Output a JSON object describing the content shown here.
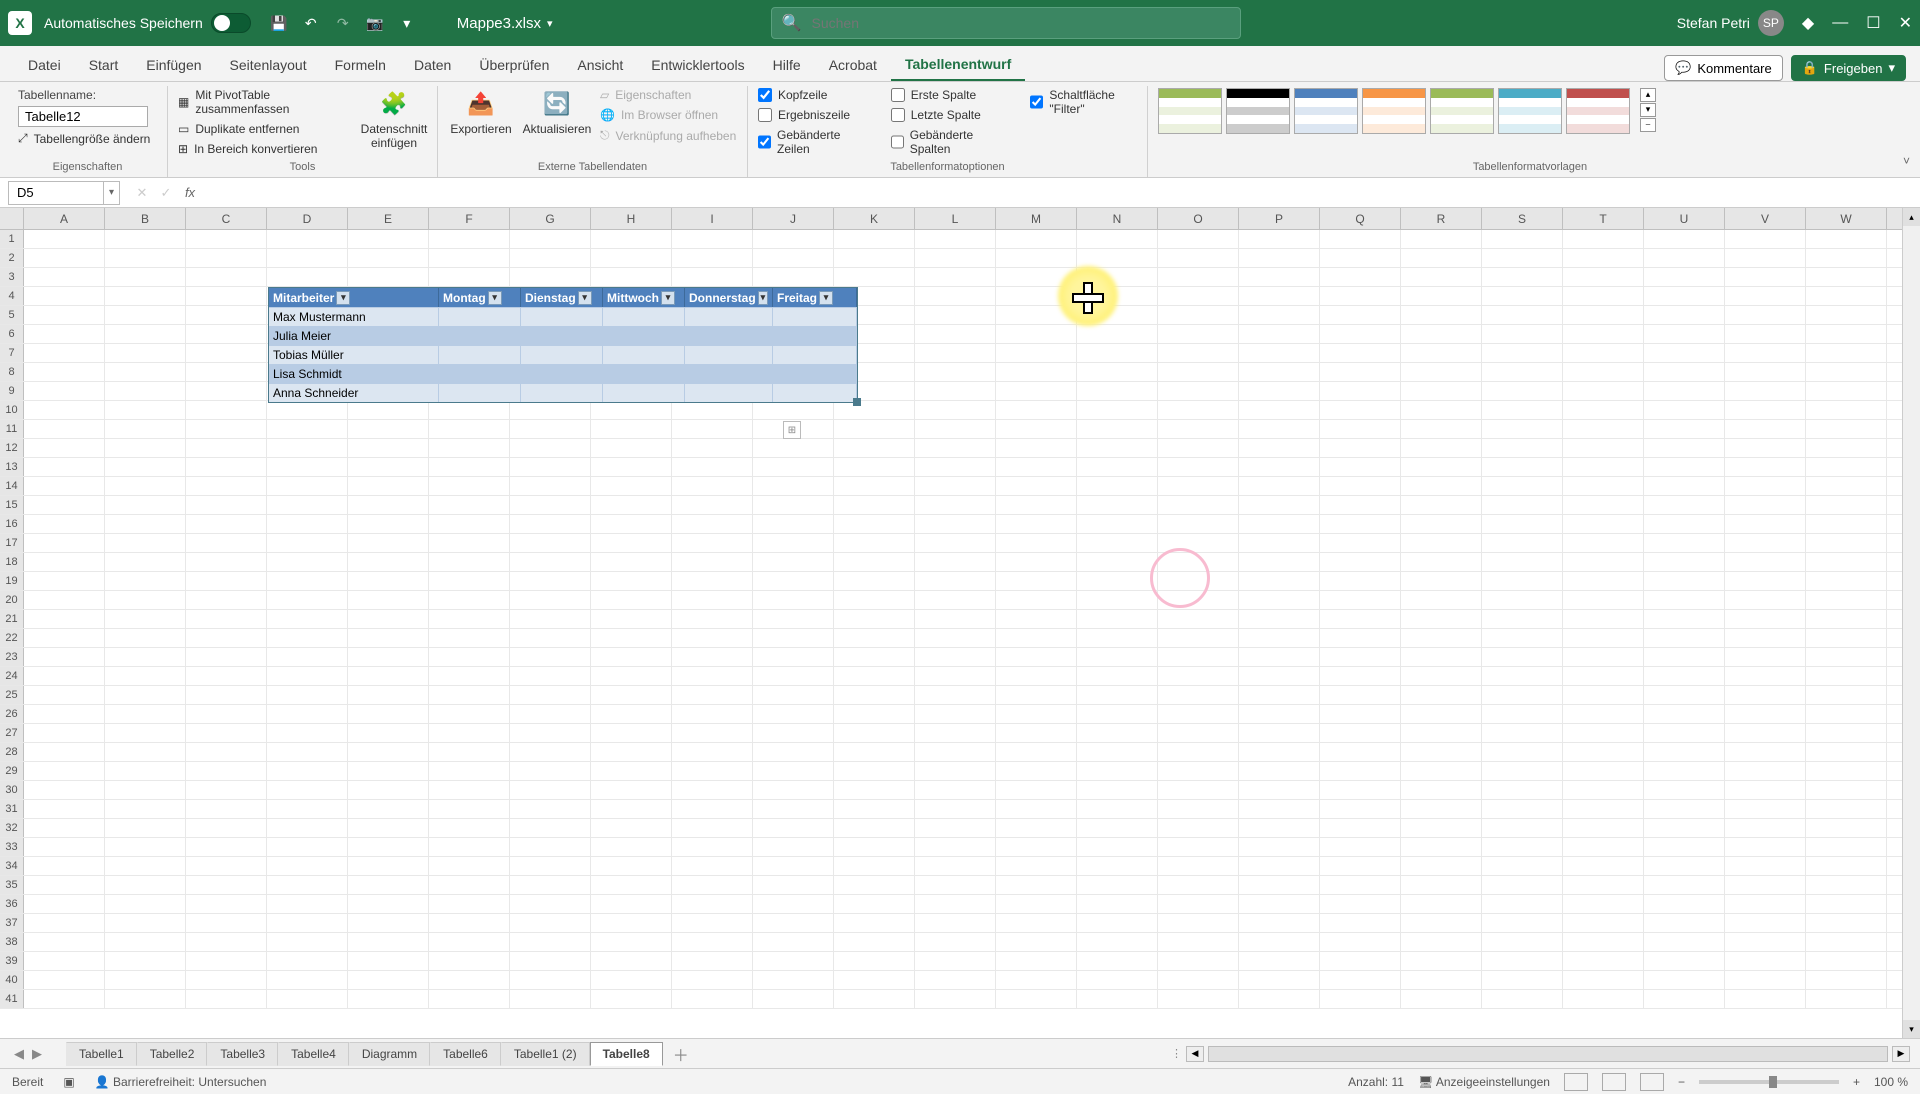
{
  "titlebar": {
    "autosave_label": "Automatisches Speichern",
    "filename": "Mappe3.xlsx",
    "search_placeholder": "Suchen",
    "user_name": "Stefan Petri",
    "user_initials": "SP"
  },
  "tabs": {
    "items": [
      "Datei",
      "Start",
      "Einfügen",
      "Seitenlayout",
      "Formeln",
      "Daten",
      "Überprüfen",
      "Ansicht",
      "Entwicklertools",
      "Hilfe",
      "Acrobat",
      "Tabellenentwurf"
    ],
    "active_index": 11,
    "kommentare": "Kommentare",
    "freigeben": "Freigeben"
  },
  "ribbon": {
    "tablename_label": "Tabellenname:",
    "tablename_value": "Tabelle12",
    "resize_table": "Tabellengröße ändern",
    "group_props": "Eigenschaften",
    "pivot": "Mit PivotTable zusammenfassen",
    "dupes": "Duplikate entfernen",
    "convert": "In Bereich konvertieren",
    "slicer": "Datenschnitt einfügen",
    "group_tools": "Tools",
    "export": "Exportieren",
    "refresh": "Aktualisieren",
    "props": "Eigenschaften",
    "open_browser": "Im Browser öffnen",
    "unlink": "Verknüpfung aufheben",
    "group_ext": "Externe Tabellendaten",
    "header_row": "Kopfzeile",
    "total_row": "Ergebniszeile",
    "banded_rows": "Gebänderte Zeilen",
    "first_col": "Erste Spalte",
    "last_col": "Letzte Spalte",
    "banded_cols": "Gebänderte Spalten",
    "filter_btn": "Schaltfläche \"Filter\"",
    "group_styleopts": "Tabellenformatoptionen",
    "group_styles": "Tabellenformatvorlagen"
  },
  "formulabar": {
    "cellref": "D5",
    "fx": "fx",
    "formula": ""
  },
  "columns": [
    "A",
    "B",
    "C",
    "D",
    "E",
    "F",
    "G",
    "H",
    "I",
    "J",
    "K",
    "L",
    "M",
    "N",
    "O",
    "P",
    "Q",
    "R",
    "S",
    "T",
    "U",
    "V",
    "W"
  ],
  "table": {
    "headers": [
      "Mitarbeiter",
      "Montag",
      "Dienstag",
      "Mittwoch",
      "Donnerstag",
      "Freitag"
    ],
    "rows": [
      [
        "Max Mustermann",
        "",
        "",
        "",
        "",
        ""
      ],
      [
        "Julia Meier",
        "",
        "",
        "",
        "",
        ""
      ],
      [
        "Tobias Müller",
        "",
        "",
        "",
        "",
        ""
      ],
      [
        "Lisa Schmidt",
        "",
        "",
        "",
        "",
        ""
      ],
      [
        "Anna Schneider",
        "",
        "",
        "",
        "",
        ""
      ]
    ]
  },
  "sheets": {
    "items": [
      "Tabelle1",
      "Tabelle2",
      "Tabelle3",
      "Tabelle4",
      "Diagramm",
      "Tabelle6",
      "Tabelle1 (2)",
      "Tabelle8"
    ],
    "active_index": 7
  },
  "status": {
    "ready": "Bereit",
    "accessibility": "Barrierefreiheit: Untersuchen",
    "count_label": "Anzahl:",
    "count_value": "11",
    "display": "Anzeigeeinstellungen",
    "zoom": "100 %"
  },
  "style_colors": [
    "#9bbb59",
    "#000000",
    "#4f81bd",
    "#f79646",
    "#9bbb59",
    "#4bacc6",
    "#c0504d"
  ]
}
